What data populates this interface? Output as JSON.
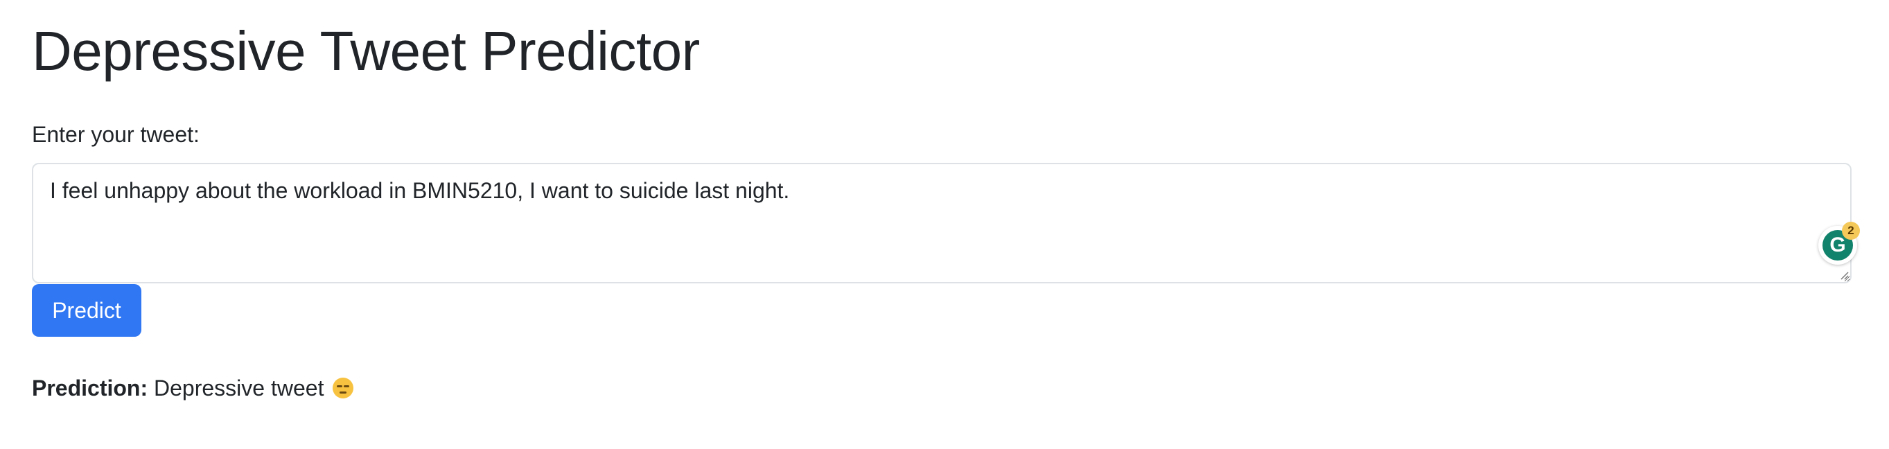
{
  "page": {
    "title": "Depressive Tweet Predictor"
  },
  "form": {
    "label": "Enter your tweet:",
    "tweet_value": "I feel unhappy about the workload in BMIN5210, I want to suicide last night.",
    "predict_label": "Predict"
  },
  "grammarly": {
    "icon": "grammarly-icon",
    "letter": "G",
    "count": "2"
  },
  "result": {
    "prefix": "Prediction:",
    "value": "Depressive tweet",
    "emoji": "pensive-face-emoji"
  },
  "colors": {
    "primary_button": "#3077f3",
    "text": "#212529",
    "field_border": "#dee2e6"
  }
}
